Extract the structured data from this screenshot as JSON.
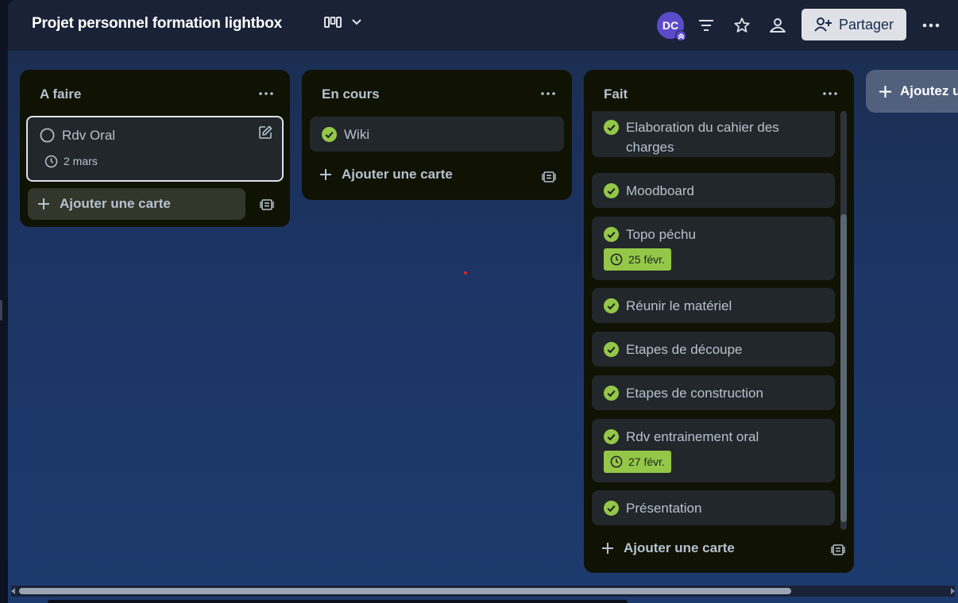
{
  "header": {
    "board_title": "Projet personnel formation lightbox",
    "avatar_initials": "DC",
    "share_label": "Partager"
  },
  "lists": [
    {
      "title": "A faire",
      "cards": [
        {
          "title": "Rdv Oral",
          "done": false,
          "date": "2 mars"
        }
      ],
      "add_label": "Ajouter une carte"
    },
    {
      "title": "En cours",
      "cards": [
        {
          "title": "Wiki",
          "done": true
        }
      ],
      "add_label": "Ajouter une carte"
    },
    {
      "title": "Fait",
      "cards": [
        {
          "title_line1": "Elaboration du cahier des",
          "title_line2": "charges",
          "done": true
        },
        {
          "title": "Moodboard",
          "done": true
        },
        {
          "title": "Topo péchu",
          "done": true,
          "date": "25 févr."
        },
        {
          "title": "Réunir le matériel",
          "done": true
        },
        {
          "title": "Etapes de découpe",
          "done": true
        },
        {
          "title": "Etapes de construction",
          "done": true
        },
        {
          "title": "Rdv entrainement oral",
          "done": true,
          "date": "27 févr."
        },
        {
          "title": "Présentation",
          "done": true
        }
      ],
      "add_label": "Ajouter une carte"
    }
  ],
  "add_list_label": "Ajoutez u",
  "colors": {
    "list_bg": "#101204",
    "card_bg": "#22272b",
    "done_green": "#94c748",
    "avatar": "#5c4bc9"
  }
}
